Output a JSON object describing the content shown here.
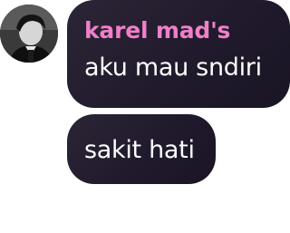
{
  "conversation": {
    "avatar_icon": "user-avatar-photo",
    "sender": {
      "name": "karel mad's",
      "color": "#ef80c8"
    },
    "messages": [
      {
        "text": "aku mau sndiri"
      },
      {
        "text": "sakit hati"
      }
    ],
    "bubble_color": "#241e30",
    "text_color": "#ffffff"
  }
}
